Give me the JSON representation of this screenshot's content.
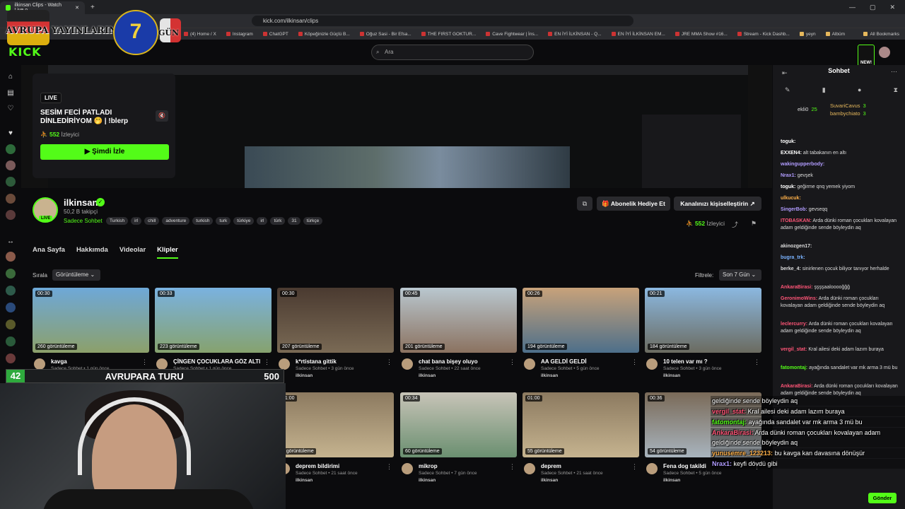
{
  "browser": {
    "tab_title": "ilkinsan Clips - Watch Live o",
    "url": "kick.com/ilkinsan/clips",
    "bookmarks": [
      "(4) Home / X",
      "Instagram",
      "ChatGPT",
      "Köpeğinizle Güçlü B...",
      "Oğuz Sasi - Bir Efsa...",
      "THE FIRST GOKTUR...",
      "Cave Fightwear | İns...",
      "EN İYİ İLKİNSAN - Q...",
      "EN İYİ İLKİNSAN EM...",
      "JRE MMA Show #16...",
      "Stream - Kick Dashb...",
      "yeyn",
      "Albüm"
    ],
    "all_bookmarks": "All Bookmarks"
  },
  "overlay": {
    "title": "AVRUPA YAYINLARINA",
    "day_number": "7",
    "day_label": "GÜN",
    "level": "42",
    "level_text": "AVRUPARA TURU",
    "level_value": "500"
  },
  "site": {
    "logo": "KICK",
    "search_placeholder": "Ara",
    "new_badge": "NEW!"
  },
  "live_card": {
    "badge": "LIVE",
    "title": "SESİM FECİ PATLADI DİNLEDİRİYOM 🤭 | !blerp",
    "viewers_count": "552",
    "viewers_label": "İzleyici",
    "watch_button": "Şimdi İzle"
  },
  "channel": {
    "name": "ilkinsan",
    "followers": "50,2 B takipçi",
    "category": "Sadece Sohbet",
    "live_pill": "LIVE",
    "tags": [
      "Turkish",
      "irl",
      "chill",
      "adventure",
      "turkish",
      "turk",
      "türkiye",
      "irl",
      "türk",
      "31",
      "türkçe"
    ],
    "gift_button": "Abonelik Hediye Et",
    "customize_button": "Kanalınızı kişiselleştirin",
    "viewers_count": "552",
    "viewers_label": "İzleyici"
  },
  "tabs": [
    "Ana Sayfa",
    "Hakkımda",
    "Videolar",
    "Klipler"
  ],
  "active_tab": "Klipler",
  "sort": {
    "label": "Sırala",
    "value": "Görüntüleme"
  },
  "filter": {
    "label": "Filtrele:",
    "value": "Son 7 Gün"
  },
  "clips": [
    {
      "duration": "00:30",
      "views": "260 görüntüleme",
      "title": "kavga",
      "meta": "Sadece Sohbet • 1 gün önce",
      "channel": "ilkinsan",
      "colors": [
        "#6ea8d8",
        "#8ca06a"
      ]
    },
    {
      "duration": "00:33",
      "views": "223 görüntüleme",
      "title": "ÇİNGEN ÇOCUKLARA GÖZ ALTI",
      "meta": "Sadece Sohbet • 1 gün önce",
      "channel": "ilkinsan",
      "colors": [
        "#7ab2e0",
        "#86a26e"
      ]
    },
    {
      "duration": "00:30",
      "views": "207 görüntüleme",
      "title": "k*rtistana gittik",
      "meta": "Sadece Sohbet • 3 gün önce",
      "channel": "ilkinsan",
      "colors": [
        "#4a3a30",
        "#7a6a55"
      ]
    },
    {
      "duration": "00:45",
      "views": "201 görüntüleme",
      "title": "chat bana bişey oluyo",
      "meta": "Sadece Sohbet • 22 saat önce",
      "channel": "ilkinsan",
      "colors": [
        "#b9c7cf",
        "#8b7260"
      ]
    },
    {
      "duration": "00:26",
      "views": "194 görüntüleme",
      "title": "AA GELDİ GELDİ",
      "meta": "Sadece Sohbet • 5 gün önce",
      "channel": "ilkinsan",
      "colors": [
        "#c8a27a",
        "#4d6f8a"
      ]
    },
    {
      "duration": "00:21",
      "views": "184 görüntüleme",
      "title": "10 telen var mı ?",
      "meta": "Sadece Sohbet • 3 gün önce",
      "channel": "ilkinsan",
      "colors": [
        "#8bb8e0",
        "#6b6b60"
      ]
    },
    {
      "duration": "01:00",
      "views": "3 görüntüleme",
      "title": "deprem bildirimi",
      "meta": "Sadece Sohbet • 21 saat önce",
      "channel": "ilkinsan",
      "colors": [
        "#8c7a60",
        "#c5b38f"
      ]
    },
    {
      "duration": "00:34",
      "views": "60 görüntüleme",
      "title": "mikrop",
      "meta": "Sadece Sohbet • 7 gün önce",
      "channel": "ilkinsan",
      "colors": [
        "#c8c4b8",
        "#6a8f70"
      ]
    },
    {
      "duration": "01:00",
      "views": "55 görüntüleme",
      "title": "deprem",
      "meta": "Sadece Sohbet • 21 saat önce",
      "channel": "ilkinsan",
      "colors": [
        "#8c7a60",
        "#c5b38f"
      ]
    },
    {
      "duration": "00:36",
      "views": "54 görüntüleme",
      "title": "Fena dog takildi",
      "meta": "Sadece Sohbet • 5 gün önce",
      "channel": "ilkinsan",
      "colors": [
        "#7a6a58",
        "#a8b4be"
      ]
    }
  ],
  "chat": {
    "header": "Sohbet",
    "gift_users": [
      {
        "name": "ekli0",
        "count": "25"
      },
      {
        "name": "SuvariCavus",
        "count": "3"
      },
      {
        "name": "bambychiato",
        "count": "3"
      }
    ],
    "messages": [
      {
        "user": "toguk:",
        "text": "",
        "color": "#fff"
      },
      {
        "user": "EXXEN4:",
        "text": "alt tabakanın en altı",
        "color": "#fff"
      },
      {
        "user": "wakingupperbody:",
        "text": "",
        "color": "#b19cff"
      },
      {
        "user": "Nrax1:",
        "text": "gevşek",
        "color": "#b19cff"
      },
      {
        "user": "toguk:",
        "text": "geğirme qnq yemek yiyom",
        "color": "#fff"
      },
      {
        "user": "ulkucuk:",
        "text": "",
        "color": "#ffb14a"
      },
      {
        "user": "SingerBob:",
        "text": "gevseqq",
        "color": "#b19cff"
      },
      {
        "user": "ITOBASKAN:",
        "text": "Arda dünki roman çocukları kovalayan adam geldiğinde sende böyleydin aq",
        "color": "#ff5577"
      },
      {
        "user": "akinozgen17:",
        "text": "",
        "color": "#ddd"
      },
      {
        "user": "bugra_trk:",
        "text": "",
        "color": "#7ab3ff"
      },
      {
        "user": "berke_4:",
        "text": "sinirlenen çocuk biliyor tanıyor herhalde",
        "color": "#ddd"
      },
      {
        "user": "AnkaraBirasi:",
        "text": "şşşşaalooooğğğ",
        "color": "#ff5577"
      },
      {
        "user": "GeronimoWins:",
        "text": "Arda dünki roman çocukları kovalayan adam geldiğinde sende böyleydin aq",
        "color": "#ff5577"
      },
      {
        "user": "leclercurry:",
        "text": "Arda dünki roman çocukları kovalayan adam geldiğinde sende böyleydin aq",
        "color": "#ff5577"
      },
      {
        "user": "vergil_stat:",
        "text": "Kral ailesi deki adam lazım buraya",
        "color": "#ff5577"
      },
      {
        "user": "fatomontaj:",
        "text": "ayağında sandalet var mk arma 3 mü bu",
        "color": "#53fc18"
      },
      {
        "user": "AnkaraBirasi:",
        "text": "Arda dünki roman çocukları kovalayan adam geldiğinde sende böyleydin aq",
        "color": "#ff5577"
      }
    ],
    "overlay_messages": [
      {
        "user": "",
        "text": "geldiğinde sende böyleydin aq",
        "color": "#fff"
      },
      {
        "user": "vergil_stat:",
        "text": "Kral ailesi deki adam lazım buraya",
        "color": "#ff5577"
      },
      {
        "user": "fatomontaj:",
        "text": "ayağında sandalet var mk arma 3 mü bu",
        "color": "#53fc18"
      },
      {
        "user": "AnkaraBirasi:",
        "text": "Arda dünki roman çocukları kovalayan adam geldiğinde sende böyleydin aq",
        "color": "#ff5577"
      },
      {
        "user": "yunusemre_123213:",
        "text": "bu kavga kan davasına dönüşür",
        "color": "#ffb14a"
      },
      {
        "user": "Nrax1:",
        "text": "keyfi dövdü gibi",
        "color": "#b19cff"
      }
    ],
    "send_button": "Gönder"
  },
  "colors": {
    "accent": "#53fc18",
    "background": "#0b0b0d",
    "panel": "#18181b"
  }
}
